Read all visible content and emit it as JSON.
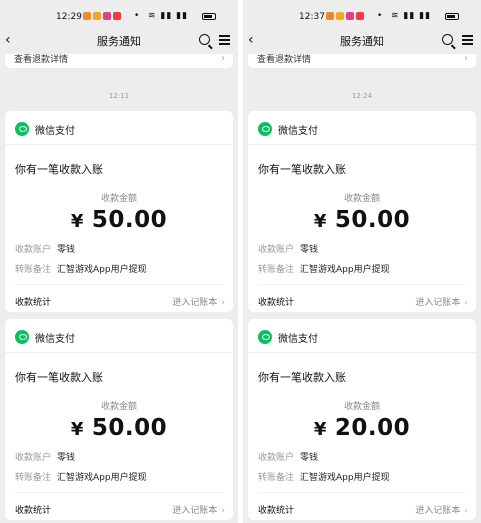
{
  "phones": [
    {
      "status_time": "12:29",
      "nav_title": "服务通知",
      "refund_text": "查看退款详情",
      "timestamp": "12:11",
      "cards": [
        {
          "brand": "微信支付",
          "headline": "你有一笔收款入账",
          "amount_label": "收款金额",
          "currency": "¥",
          "amount": "50.00",
          "account_key": "收款账户",
          "account_value": "零钱",
          "remark_key": "转账备注",
          "remark_value": "汇智游戏App用户提现",
          "stats_label": "收款统计",
          "ledger_label": "进入记账本"
        },
        {
          "brand": "微信支付",
          "headline": "你有一笔收款入账",
          "amount_label": "收款金额",
          "currency": "¥",
          "amount": "50.00",
          "account_key": "收款账户",
          "account_value": "零钱",
          "remark_key": "转账备注",
          "remark_value": "汇智游戏App用户提现",
          "stats_label": "收款统计",
          "ledger_label": "进入记账本"
        }
      ]
    },
    {
      "status_time": "12:37",
      "nav_title": "服务通知",
      "refund_text": "查看退款详情",
      "timestamp": "12:24",
      "cards": [
        {
          "brand": "微信支付",
          "headline": "你有一笔收款入账",
          "amount_label": "收款金额",
          "currency": "¥",
          "amount": "50.00",
          "account_key": "收款账户",
          "account_value": "零钱",
          "remark_key": "转账备注",
          "remark_value": "汇智游戏App用户提现",
          "stats_label": "收款统计",
          "ledger_label": "进入记账本"
        },
        {
          "brand": "微信支付",
          "headline": "你有一笔收款入账",
          "amount_label": "收款金额",
          "currency": "¥",
          "amount": "20.00",
          "account_key": "收款账户",
          "account_value": "零钱",
          "remark_key": "转账备注",
          "remark_value": "汇智游戏App用户提现",
          "stats_label": "收款统计",
          "ledger_label": "进入记账本"
        }
      ]
    }
  ],
  "icons": {
    "back": "chevron-left-icon",
    "search": "search-icon",
    "menu": "menu-icon",
    "brand_logo": "wechat-pay-logo-icon",
    "chevron": "chevron-right-icon"
  },
  "colors": {
    "background": "#ededed",
    "card": "#ffffff",
    "wechat_green": "#07c160",
    "muted_text": "#999999"
  }
}
